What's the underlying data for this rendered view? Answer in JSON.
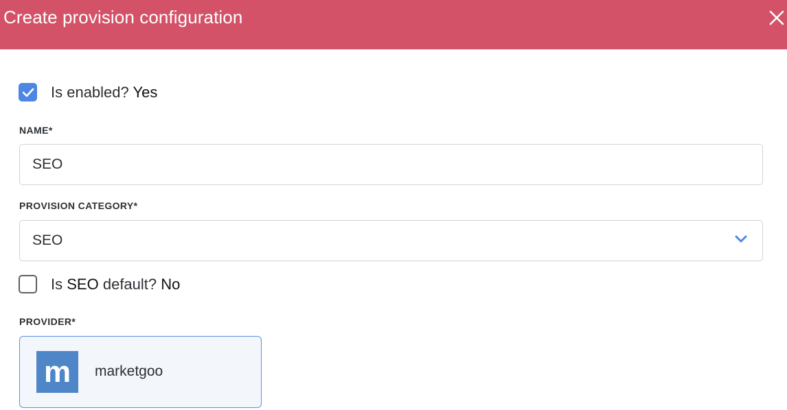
{
  "dialog": {
    "title": "Create provision configuration",
    "close_icon": "close-icon"
  },
  "form": {
    "enabled": {
      "checked": true,
      "label_prefix": "Is enabled?",
      "label_value": "Yes"
    },
    "name": {
      "label": "NAME*",
      "value": "SEO"
    },
    "provision_category": {
      "label": "PROVISION CATEGORY*",
      "selected": "SEO",
      "chevron_icon": "chevron-down-icon"
    },
    "is_default": {
      "checked": false,
      "label_prefix": "Is",
      "label_category": "SEO",
      "label_middle": "default?",
      "label_value": "No"
    },
    "provider": {
      "label": "PROVIDER*",
      "selected": {
        "name": "marketgoo",
        "logo_letter": "m",
        "logo_icon": "marketgoo-logo-icon"
      }
    }
  },
  "colors": {
    "header_bg": "#d35267",
    "accent": "#4f86e4",
    "provider_border": "#5b8fe6",
    "logo_bg": "#4f86c8"
  }
}
